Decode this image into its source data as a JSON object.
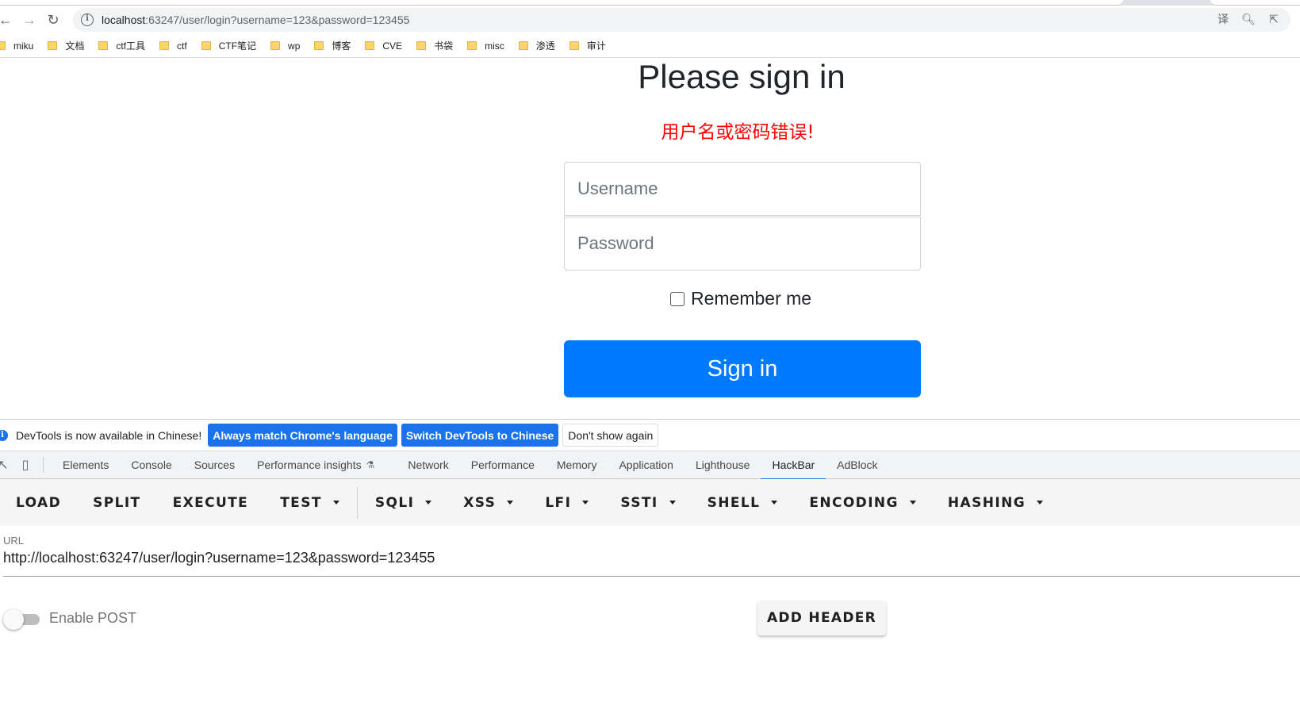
{
  "browser": {
    "url_host": "localhost",
    "url_rest": ":63247/user/login?username=123&password=123455",
    "bookmarks": [
      "miku",
      "文档",
      "ctf工具",
      "ctf",
      "CTF笔记",
      "wp",
      "博客",
      "CVE",
      "书袋",
      "misc",
      "渗透",
      "审计"
    ]
  },
  "page": {
    "title": "Please sign in",
    "error": "用户名或密码错误!",
    "username_placeholder": "Username",
    "password_placeholder": "Password",
    "remember_label": "Remember me",
    "signin_label": "Sign in"
  },
  "devtools": {
    "infobar": {
      "message": "DevTools is now available in Chinese!",
      "btn_match": "Always match Chrome's language",
      "btn_switch": "Switch DevTools to Chinese",
      "btn_dismiss": "Don't show again"
    },
    "tabs": [
      "Elements",
      "Console",
      "Sources",
      "Performance insights",
      "Network",
      "Performance",
      "Memory",
      "Application",
      "Lighthouse",
      "HackBar",
      "AdBlock"
    ],
    "active_tab": "HackBar"
  },
  "hackbar": {
    "buttons": [
      "LOAD",
      "SPLIT",
      "EXECUTE",
      "TEST",
      "SQLI",
      "XSS",
      "LFI",
      "SSTI",
      "SHELL",
      "ENCODING",
      "HASHING"
    ],
    "url_label": "URL",
    "url_value": "http://localhost:63247/user/login?username=123&password=123455",
    "enable_post_label": "Enable POST",
    "enable_post_on": false,
    "add_header_label": "ADD HEADER"
  },
  "colors": {
    "primary": "#007bff",
    "error": "#ff0000",
    "devtools_accent": "#1a73e8"
  }
}
